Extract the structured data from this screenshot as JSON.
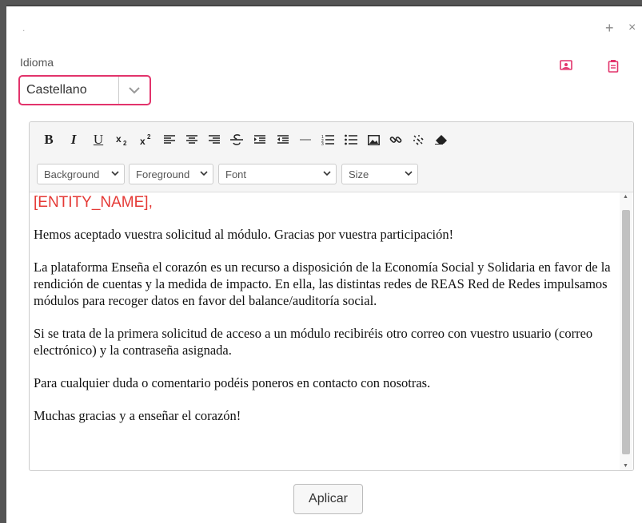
{
  "header": {
    "title_mark": ".",
    "plus_label": "+",
    "close_label": "×"
  },
  "language": {
    "label": "Idioma",
    "selected": "Castellano"
  },
  "top_icons": [
    "image-icon",
    "clipboard-icon"
  ],
  "accent_color": "#e2336b",
  "toolbar": {
    "buttons": [
      "bold",
      "italic",
      "underline",
      "subscript",
      "superscript",
      "align-left",
      "align-center",
      "align-right",
      "strikethrough",
      "indent",
      "outdent",
      "horizontal-rule",
      "ordered-list",
      "unordered-list",
      "insert-image",
      "insert-link",
      "remove-link",
      "eraser"
    ],
    "bold_label": "B",
    "italic_label": "I",
    "underline_label": "U",
    "background_label": "Background",
    "foreground_label": "Foreground",
    "font_label": "Font",
    "size_label": "Size"
  },
  "content": {
    "entity": "[ENTITY_NAME],",
    "paragraphs": [
      "Hemos aceptado vuestra solicitud al módulo. Gracias por vuestra participación!",
      "La plataforma Enseña el corazón es un recurso a disposición de la Economía Social y Solidaria en favor de la rendición de cuentas y la medida de impacto. En ella, las distintas redes de REAS Red de Redes impulsamos módulos para recoger datos en favor del balance/auditoría social.",
      "Si se trata de la primera solicitud de acceso a un módulo recibiréis otro correo con vuestro usuario (correo electrónico) y la contraseña asignada.",
      "Para cualquier duda o comentario podéis poneros en contacto con nosotras.",
      "Muchas gracias y a enseñar el corazón!"
    ]
  },
  "apply_label": "Aplicar"
}
